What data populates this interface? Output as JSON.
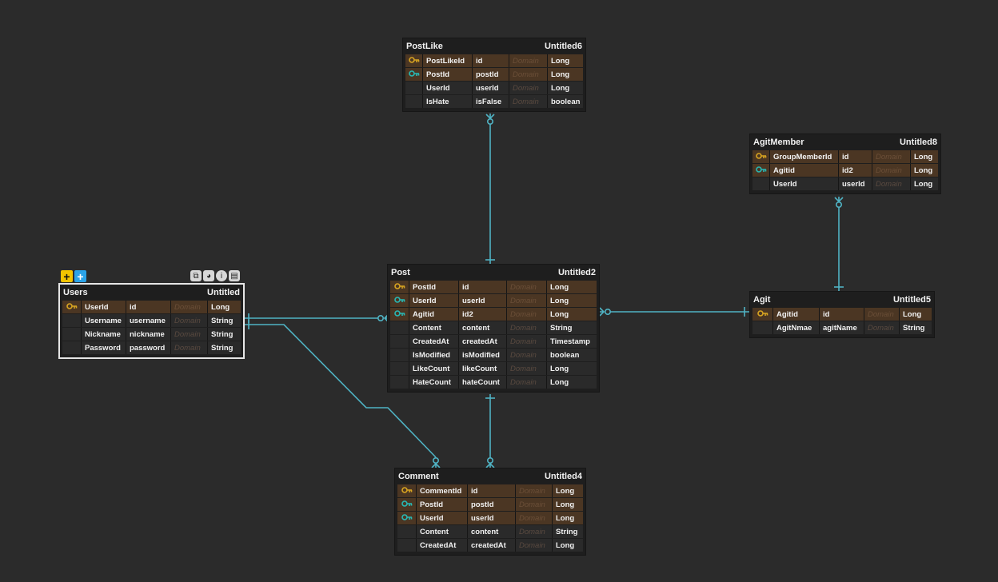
{
  "colors": {
    "background": "#2b2b2b",
    "table_bg": "#1e1e1e",
    "key_row": "#4b3623",
    "pk_icon": "#d9a521",
    "fk_icon": "#28b9b5",
    "relation_line": "#4fb3c4"
  },
  "toolbar": {
    "add_left_label": "+",
    "add_right_label": "+",
    "icons": [
      "copy-icon",
      "palette-icon",
      "info-icon",
      "trash-icon"
    ]
  },
  "domain_placeholder": "Domain",
  "tables": {
    "postlike": {
      "name": "PostLike",
      "tag": "Untitled6",
      "rows": [
        {
          "key": "pk",
          "logical": "PostLikeId",
          "physical": "id",
          "type": "Long"
        },
        {
          "key": "fk",
          "logical": "PostId",
          "physical": "postId",
          "type": "Long"
        },
        {
          "key": "",
          "logical": "UserId",
          "physical": "userId",
          "type": "Long"
        },
        {
          "key": "",
          "logical": "IsHate",
          "physical": "isFalse",
          "type": "boolean"
        }
      ]
    },
    "agitmember": {
      "name": "AgitMember",
      "tag": "Untitled8",
      "rows": [
        {
          "key": "pk",
          "logical": "GroupMemberId",
          "physical": "id",
          "type": "Long"
        },
        {
          "key": "fk",
          "logical": "Agitid",
          "physical": "id2",
          "type": "Long"
        },
        {
          "key": "",
          "logical": "UserId",
          "physical": "userId",
          "type": "Long"
        }
      ]
    },
    "users": {
      "name": "Users",
      "tag": "Untitled",
      "rows": [
        {
          "key": "pk",
          "logical": "UserId",
          "physical": "id",
          "type": "Long"
        },
        {
          "key": "",
          "logical": "Username",
          "physical": "username",
          "type": "String"
        },
        {
          "key": "",
          "logical": "Nickname",
          "physical": "nickname",
          "type": "String"
        },
        {
          "key": "",
          "logical": "Password",
          "physical": "password",
          "type": "String"
        }
      ]
    },
    "post": {
      "name": "Post",
      "tag": "Untitled2",
      "rows": [
        {
          "key": "pk",
          "logical": "PostId",
          "physical": "id",
          "type": "Long"
        },
        {
          "key": "fk",
          "logical": "UserId",
          "physical": "userId",
          "type": "Long"
        },
        {
          "key": "fk",
          "logical": "Agitid",
          "physical": "id2",
          "type": "Long"
        },
        {
          "key": "",
          "logical": "Content",
          "physical": "content",
          "type": "String"
        },
        {
          "key": "",
          "logical": "CreatedAt",
          "physical": "createdAt",
          "type": "Timestamp"
        },
        {
          "key": "",
          "logical": "IsModified",
          "physical": "isModified",
          "type": "boolean"
        },
        {
          "key": "",
          "logical": "LikeCount",
          "physical": "likeCount",
          "type": "Long"
        },
        {
          "key": "",
          "logical": "HateCount",
          "physical": "hateCount",
          "type": "Long"
        }
      ]
    },
    "agit": {
      "name": "Agit",
      "tag": "Untitled5",
      "rows": [
        {
          "key": "pk",
          "logical": "Agitid",
          "physical": "id",
          "type": "Long"
        },
        {
          "key": "",
          "logical": "AgitNmae",
          "physical": "agitName",
          "type": "String"
        }
      ]
    },
    "comment": {
      "name": "Comment",
      "tag": "Untitled4",
      "rows": [
        {
          "key": "pk",
          "logical": "CommentId",
          "physical": "id",
          "type": "Long"
        },
        {
          "key": "fk",
          "logical": "PostId",
          "physical": "postId",
          "type": "Long"
        },
        {
          "key": "fk",
          "logical": "UserId",
          "physical": "userId",
          "type": "Long"
        },
        {
          "key": "",
          "logical": "Content",
          "physical": "content",
          "type": "String"
        },
        {
          "key": "",
          "logical": "CreatedAt",
          "physical": "createdAt",
          "type": "Long"
        }
      ]
    }
  }
}
